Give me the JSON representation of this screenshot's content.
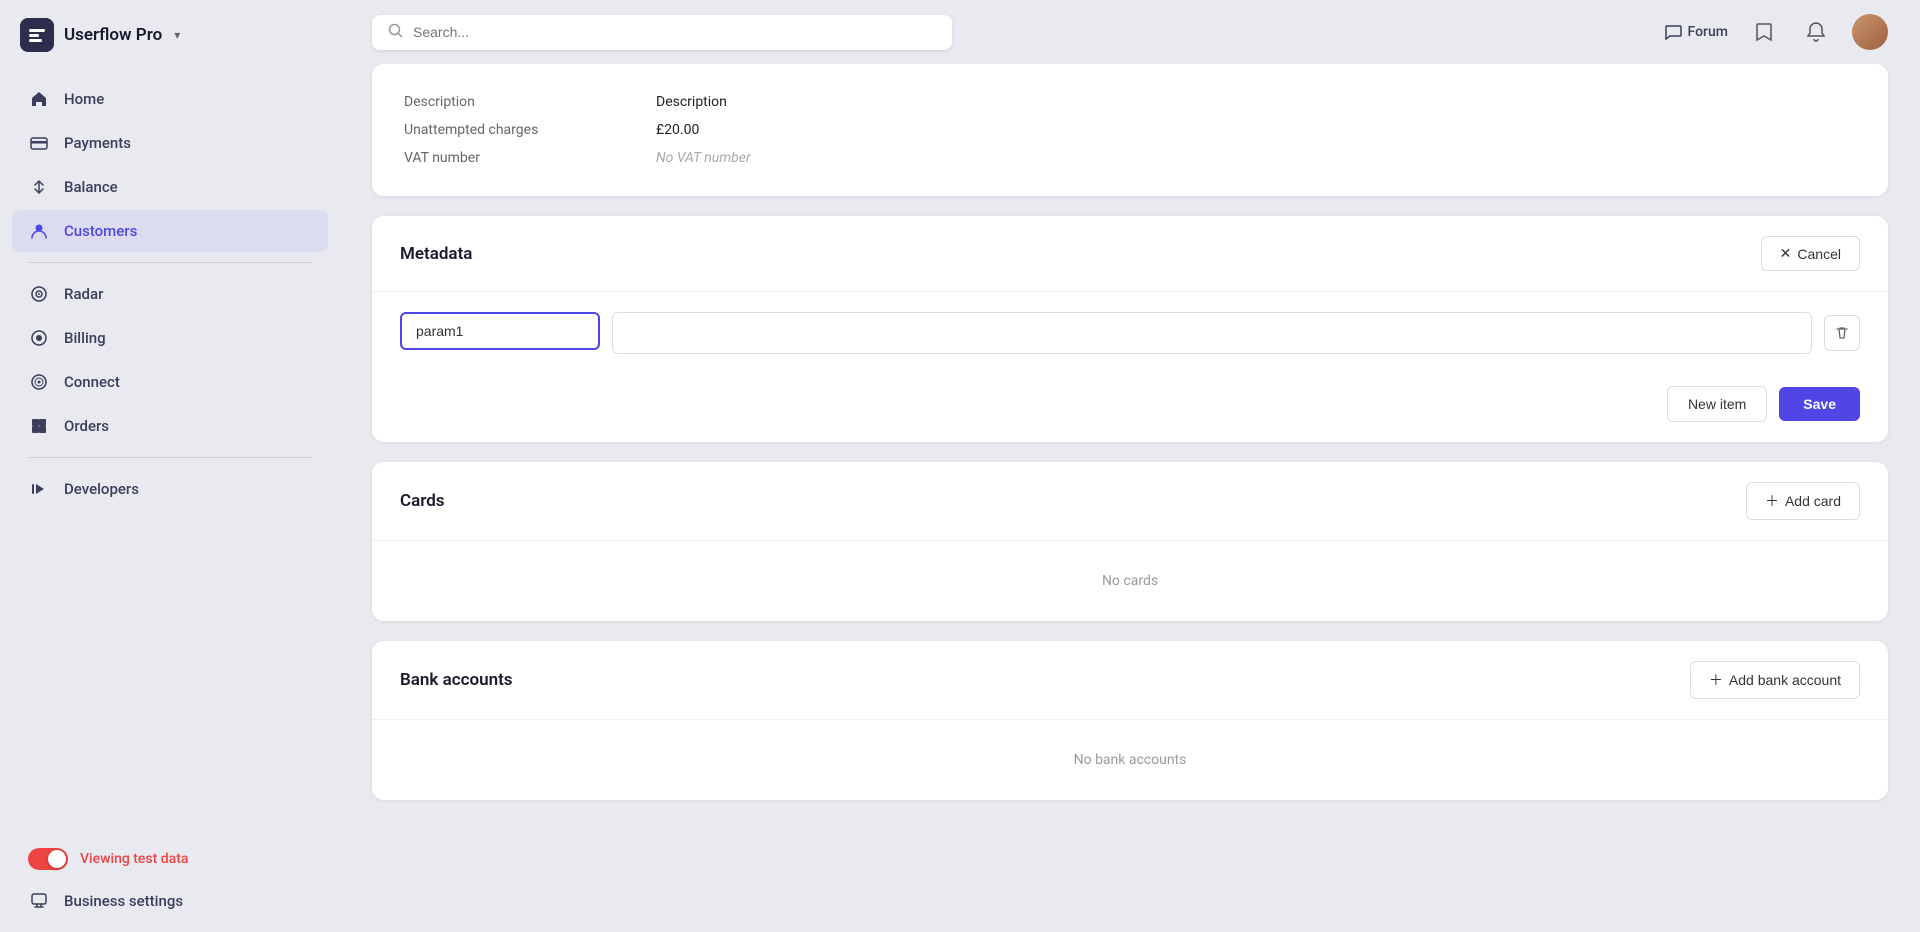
{
  "app": {
    "name": "Userflow Pro",
    "chevron": "▾"
  },
  "topbar": {
    "search_placeholder": "Search...",
    "forum_label": "Forum"
  },
  "sidebar": {
    "items": [
      {
        "id": "home",
        "label": "Home",
        "icon": "⌂",
        "active": false
      },
      {
        "id": "payments",
        "label": "Payments",
        "icon": "💳",
        "active": false
      },
      {
        "id": "balance",
        "label": "Balance",
        "icon": "⇅",
        "active": false
      },
      {
        "id": "customers",
        "label": "Customers",
        "icon": "●",
        "active": true
      },
      {
        "id": "radar",
        "label": "Radar",
        "icon": "◉",
        "active": false
      },
      {
        "id": "billing",
        "label": "Billing",
        "icon": "○",
        "active": false
      },
      {
        "id": "connect",
        "label": "Connect",
        "icon": "◎",
        "active": false
      },
      {
        "id": "orders",
        "label": "Orders",
        "icon": "▦",
        "active": false
      },
      {
        "id": "developers",
        "label": "Developers",
        "icon": "▶",
        "active": false
      }
    ],
    "viewing_test_label": "Viewing test data",
    "business_settings_label": "Business settings"
  },
  "info_section": {
    "rows": [
      {
        "label": "Description",
        "value": "Description",
        "muted": false
      },
      {
        "label": "Unattempted charges",
        "value": "£20.00",
        "muted": false
      },
      {
        "label": "VAT number",
        "value": "No VAT number",
        "muted": true
      }
    ]
  },
  "metadata": {
    "title": "Metadata",
    "cancel_label": "Cancel",
    "param_value": "param1",
    "param_placeholder": "param1",
    "value_placeholder": "",
    "new_item_label": "New item",
    "save_label": "Save"
  },
  "cards_section": {
    "title": "Cards",
    "add_label": "Add card",
    "empty_label": "No cards"
  },
  "bank_accounts_section": {
    "title": "Bank accounts",
    "add_label": "Add bank account",
    "empty_label": "No bank accounts"
  }
}
